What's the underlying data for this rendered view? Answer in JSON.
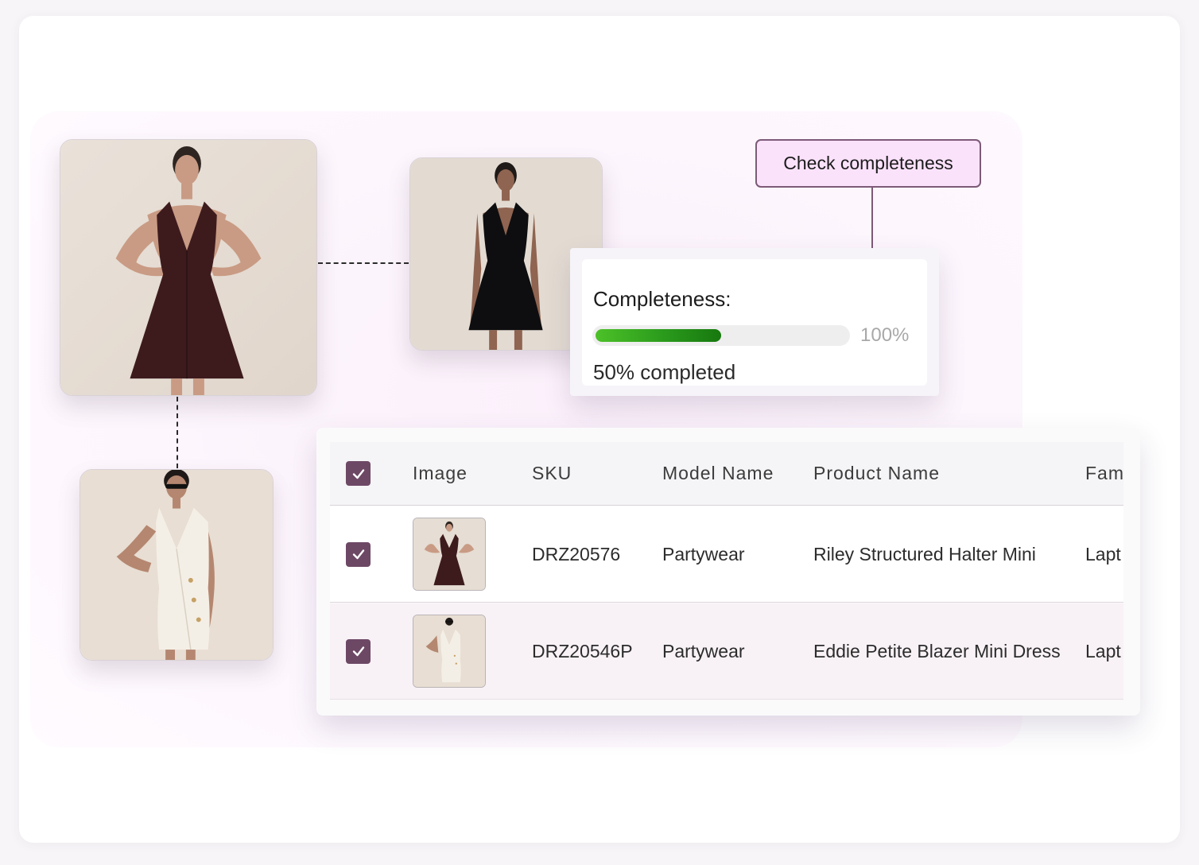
{
  "check_button": {
    "label": "Check completeness"
  },
  "completeness": {
    "title": "Completeness:",
    "progress": 0.5,
    "max_label": "100%",
    "status": "50% completed"
  },
  "table": {
    "headers": {
      "image": "Image",
      "sku": "SKU",
      "model": "Model Name",
      "product": "Product Name",
      "family": "Fam"
    },
    "rows": [
      {
        "sku": "DRZ20576",
        "model": "Partywear",
        "product": "Riley Structured Halter Mini",
        "family": "Lapt",
        "checked": true,
        "thumb": "maroon-halter-dress"
      },
      {
        "sku": "DRZ20546P",
        "model": "Partywear",
        "product": "Eddie Petite Blazer Mini Dress",
        "family": "Lapt",
        "checked": true,
        "thumb": "white-blazer-dress"
      }
    ]
  },
  "icons": {
    "checkbox": "checkmark-icon",
    "connector": "dashed-connector"
  },
  "colors": {
    "accent": "#6d4865",
    "button_bg": "#fbe2fb",
    "progress_green": "#2a9a1c"
  }
}
